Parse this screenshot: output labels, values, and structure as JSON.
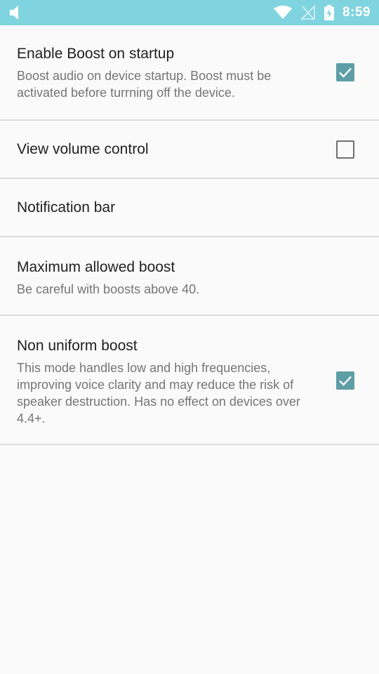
{
  "status_bar": {
    "time": "8:59",
    "icons": [
      "volume-icon",
      "wifi-icon",
      "no-sim-icon",
      "battery-charging-icon"
    ],
    "background": "#80d4df"
  },
  "settings": {
    "items": [
      {
        "title": "Enable Boost on startup",
        "summary": "Boost audio on device startup. Boost must be activated before turrning off the device.",
        "checked": true
      },
      {
        "title": "View volume control",
        "checked": false
      },
      {
        "title": "Notification bar"
      },
      {
        "title": "Maximum allowed boost",
        "summary": "Be careful with boosts above 40."
      },
      {
        "title": "Non uniform boost",
        "summary": "This mode handles low and high frequencies, improving voice clarity and may reduce the risk of speaker destruction. Has no effect on devices over 4.4+.",
        "checked": true
      }
    ]
  },
  "colors": {
    "accent": "#5e9ea6",
    "divider": "#dcdcdc",
    "background": "#fafafa"
  }
}
